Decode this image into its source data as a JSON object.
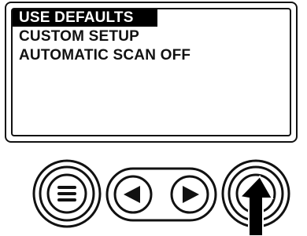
{
  "menu": {
    "items": [
      {
        "label": "USE DEFAULTS",
        "selected": true
      },
      {
        "label": "CUSTOM SETUP",
        "selected": false
      },
      {
        "label": "AUTOMATIC SCAN OFF",
        "selected": false
      }
    ]
  },
  "buttons": {
    "menu": "menu-icon",
    "left": "left-arrow-icon",
    "right": "right-arrow-icon",
    "select": "select-button-icon"
  },
  "colors": {
    "ink": "#111111",
    "background": "#ffffff",
    "highlight": "#000000"
  }
}
